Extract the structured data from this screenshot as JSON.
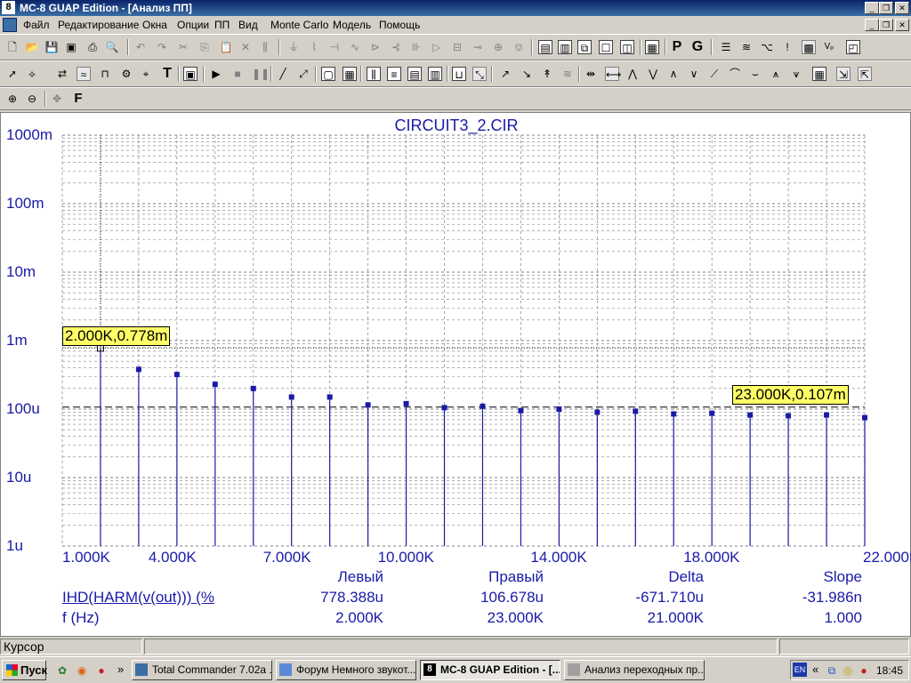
{
  "window": {
    "title": "MC-8 GUAP Edition - [Анализ ПП]",
    "app_icon": "8"
  },
  "menu": [
    "Файл",
    "Редактирование",
    "Окна",
    "Опции",
    "ПП",
    "Вид",
    "Monte Carlo",
    "Модель",
    "Помощь"
  ],
  "toolbar3": {
    "font_button": "F"
  },
  "toolbar1": {
    "p_button": "P",
    "g_button": "G"
  },
  "plot": {
    "title": "CIRCUIT3_2.CIR",
    "y_ticks": [
      "1000m",
      "100m",
      "10m",
      "1m",
      "100u",
      "10u",
      "1u"
    ],
    "x_ticks": [
      "1.000K",
      "4.000K",
      "7.000K",
      "10.000K",
      "14.000K",
      "18.000K",
      "22.000K"
    ],
    "cursor_left_label": "2.000K,0.778m",
    "cursor_right_label": "23.000K,0.107m",
    "colors": {
      "trace": "#1a1aa8",
      "grid": "#808080",
      "label_bg": "#ffff66"
    }
  },
  "chart_data": {
    "type": "bar",
    "title": "CIRCUIT3_2.CIR",
    "x_scale": "linear",
    "y_scale": "log",
    "xlim": [
      1000,
      22000
    ],
    "ylim": [
      1e-06,
      1
    ],
    "x_unit": "Hz",
    "x": [
      2000,
      3000,
      4000,
      5000,
      6000,
      7000,
      8000,
      9000,
      10000,
      11000,
      12000,
      13000,
      14000,
      15000,
      16000,
      17000,
      18000,
      19000,
      20000,
      21000,
      22000
    ],
    "values": [
      0.000778,
      0.00038,
      0.00032,
      0.00023,
      0.0002,
      0.00015,
      0.00015,
      0.000115,
      0.00012,
      0.000105,
      0.00011,
      9.5e-05,
      0.0001,
      9e-05,
      9.3e-05,
      8.5e-05,
      8.7e-05,
      8.2e-05,
      8e-05,
      8.2e-05,
      7.5e-05
    ],
    "series": [
      {
        "name": "IHD(HARM(v(out))) (%",
        "values": [
          0.000778,
          0.00038,
          0.00032,
          0.00023,
          0.0002,
          0.00015,
          0.00015,
          0.000115,
          0.00012,
          0.000105,
          0.00011,
          9.5e-05,
          0.0001,
          9e-05,
          9.3e-05,
          8.5e-05,
          8.7e-05,
          8.2e-05,
          8e-05,
          8.2e-05,
          7.5e-05
        ]
      }
    ],
    "cursors": [
      {
        "x": 2000,
        "y": 0.000778,
        "label": "2.000K,0.778m"
      },
      {
        "x": 23000,
        "y": 0.000107,
        "label": "23.000K,0.107m"
      }
    ],
    "grid": true
  },
  "table": {
    "headers": [
      "Левый",
      "Правый",
      "Delta",
      "Slope"
    ],
    "rows": [
      {
        "label": "IHD(HARM(v(out))) (%",
        "values": [
          "778.388u",
          "106.678u",
          "-671.710u",
          "-31.986n"
        ]
      },
      {
        "label": "f (Hz)",
        "values": [
          "2.000K",
          "23.000K",
          "21.000K",
          "1.000"
        ]
      }
    ]
  },
  "status": {
    "left_panel": "Курсор"
  },
  "taskbar": {
    "start": "Пуск",
    "tasks": [
      "Total Commander 7.02a ...",
      "Форум Немного звукот...",
      "MC-8 GUAP Edition - [...",
      "Анализ переходных пр..."
    ],
    "chevron": "»",
    "tray_arrows": "«",
    "lang": "EN",
    "time": "18:45"
  }
}
